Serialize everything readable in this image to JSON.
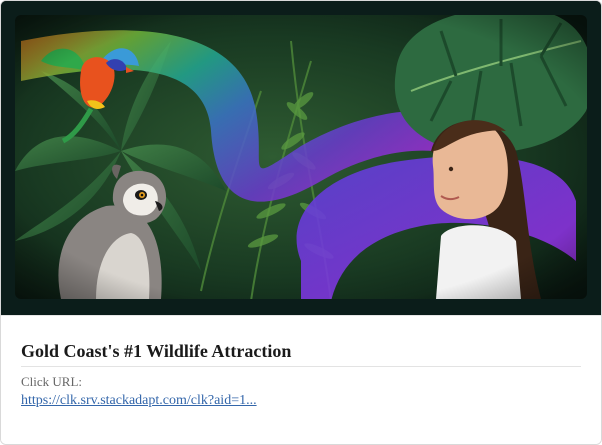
{
  "ad": {
    "headline": "Gold Coast's #1 Wildlife Attraction",
    "click_label": "Click URL:",
    "click_url": "https://clk.srv.stackadapt.com/clk?aid=1..."
  },
  "hero": {
    "subjects": [
      "rainbow-lorikeet",
      "ring-tailed-lemur",
      "girl",
      "monstera-leaf",
      "ferns"
    ],
    "colors": {
      "frame": "#0b1d1a",
      "jungle": "#1f4a2a",
      "ribbon_teal": "#2aa89a",
      "ribbon_blue": "#3d6fc4",
      "ribbon_purple": "#8a2bd6"
    }
  }
}
